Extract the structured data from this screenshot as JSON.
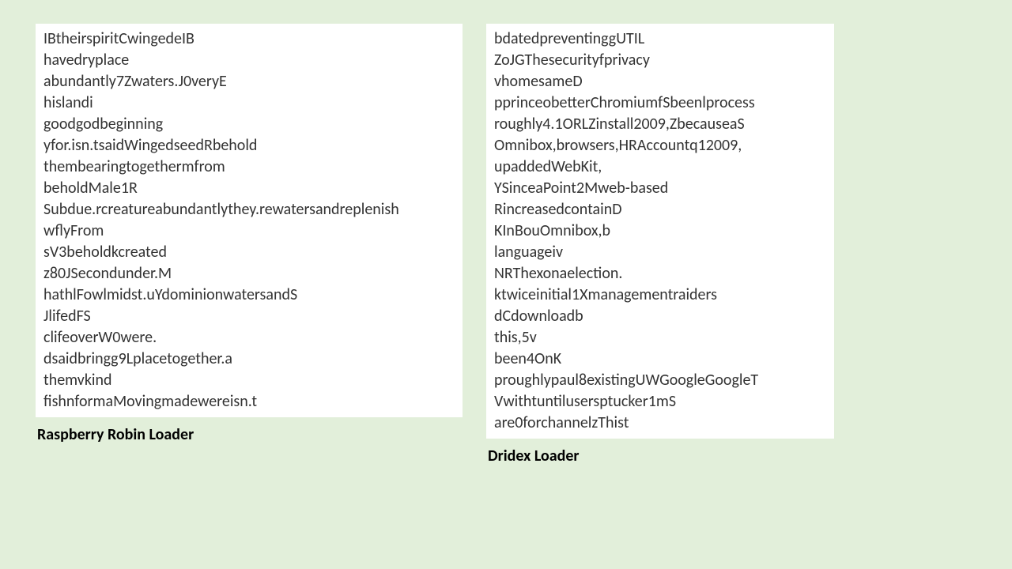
{
  "left": {
    "caption": "Raspberry Robin Loader",
    "lines": [
      "IBtheirspiritCwingedeIB",
      "havedryplace",
      "abundantly7Zwaters.J0veryE",
      "hislandi",
      "goodgodbeginning",
      "yfor.isn.tsaidWingedseedRbehold",
      "thembearingtogethermfrom",
      "beholdMale1R",
      "Subdue.rcreatureabundantlythey.rewatersandreplenish",
      "wflyFrom",
      "sV3beholdkcreated",
      "z80JSecondunder.M",
      "hathlFowlmidst.uYdominionwatersandS",
      "JlifedFS",
      "clifeoverW0were.",
      "dsaidbringg9Lplacetogether.a",
      "themvkind",
      "fishnformaMovingmadewereisn.t"
    ]
  },
  "right": {
    "caption": "Dridex Loader",
    "lines": [
      "bdatedpreventinggUTIL",
      "ZoJGThesecurityfprivacy",
      "vhomesameD",
      "pprinceobetterChromiumfSbeenlprocess",
      "roughly4.1ORLZinstall2009,ZbecauseaS",
      "Omnibox,browsers,HRAccountq12009,",
      "upaddedWebKit,",
      "YSinceaPoint2Mweb-based",
      "RincreasedcontainD",
      "KInBouOmnibox,b",
      "languageiv",
      "NRThexonaelection.",
      "ktwiceinitial1Xmanagementraiders",
      "dCdownloadb",
      "this,5v",
      "been4OnK",
      "proughlypaul8existingUWGoogleGoogleT",
      "Vwithtuntilusersptucker1mS",
      "are0forchannelzThist"
    ]
  }
}
